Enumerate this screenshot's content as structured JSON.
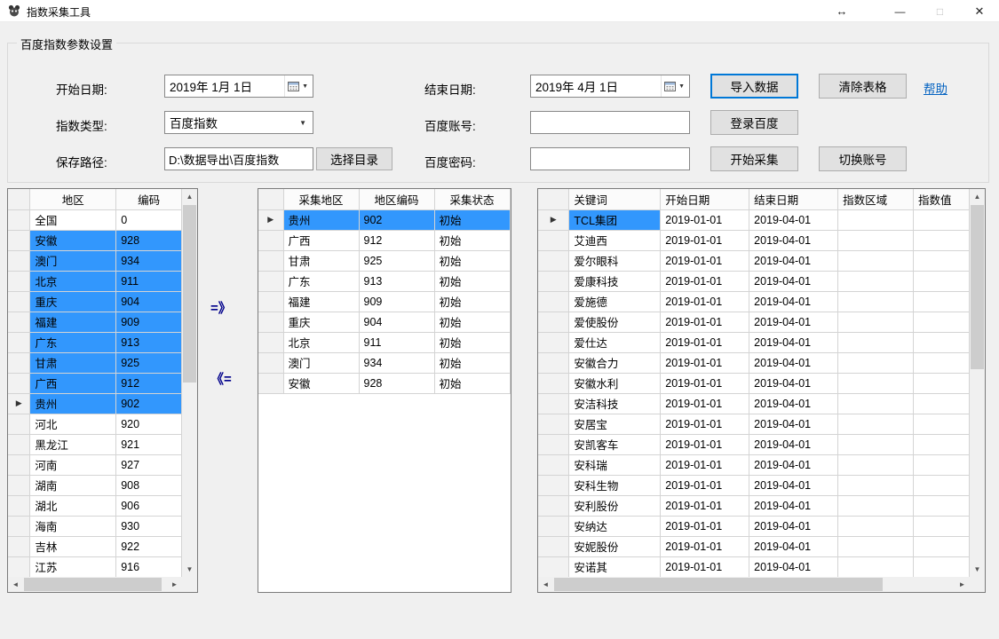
{
  "window": {
    "title": "指数采集工具",
    "resize_glyph": "↔",
    "minimize_glyph": "—",
    "maximize_glyph": "□",
    "close_glyph": "✕"
  },
  "settings": {
    "group_title": "百度指数参数设置",
    "start_date": {
      "label": "开始日期:",
      "value": "2019年 1月 1日"
    },
    "end_date": {
      "label": "结束日期:",
      "value": "2019年 4月 1日"
    },
    "index_type": {
      "label": "指数类型:",
      "value": "百度指数"
    },
    "account": {
      "label": "百度账号:",
      "value": ""
    },
    "save_path": {
      "label": "保存路径:",
      "value": "D:\\数据导出\\百度指数"
    },
    "password": {
      "label": "百度密码:",
      "value": ""
    },
    "buttons": {
      "import": "导入数据",
      "clear": "清除表格",
      "help": "帮助",
      "login": "登录百度",
      "browse": "选择目录",
      "start": "开始采集",
      "switch": "切换账号"
    }
  },
  "transfer": {
    "move_right": "=》",
    "move_left": "《="
  },
  "grids": {
    "region": {
      "columns": [
        "地区",
        "编码"
      ],
      "rows": [
        [
          "全国",
          "0"
        ],
        [
          "安徽",
          "928"
        ],
        [
          "澳门",
          "934"
        ],
        [
          "北京",
          "911"
        ],
        [
          "重庆",
          "904"
        ],
        [
          "福建",
          "909"
        ],
        [
          "广东",
          "913"
        ],
        [
          "甘肃",
          "925"
        ],
        [
          "广西",
          "912"
        ],
        [
          "贵州",
          "902"
        ],
        [
          "河北",
          "920"
        ],
        [
          "黑龙江",
          "921"
        ],
        [
          "河南",
          "927"
        ],
        [
          "湖南",
          "908"
        ],
        [
          "湖北",
          "906"
        ],
        [
          "海南",
          "930"
        ],
        [
          "吉林",
          "922"
        ],
        [
          "江苏",
          "916"
        ]
      ],
      "selected_rows": [
        1,
        2,
        3,
        4,
        5,
        6,
        7,
        8,
        9
      ],
      "current_row": 9
    },
    "collect": {
      "columns": [
        "采集地区",
        "地区编码",
        "采集状态"
      ],
      "rows": [
        [
          "贵州",
          "902",
          "初始"
        ],
        [
          "广西",
          "912",
          "初始"
        ],
        [
          "甘肃",
          "925",
          "初始"
        ],
        [
          "广东",
          "913",
          "初始"
        ],
        [
          "福建",
          "909",
          "初始"
        ],
        [
          "重庆",
          "904",
          "初始"
        ],
        [
          "北京",
          "911",
          "初始"
        ],
        [
          "澳门",
          "934",
          "初始"
        ],
        [
          "安徽",
          "928",
          "初始"
        ]
      ],
      "selected_rows": [
        0
      ],
      "current_row": 0
    },
    "keyword": {
      "columns": [
        "关键词",
        "开始日期",
        "结束日期",
        "指数区域",
        "指数值"
      ],
      "rows": [
        [
          "TCL集团",
          "2019-01-01",
          "2019-04-01",
          "",
          ""
        ],
        [
          "艾迪西",
          "2019-01-01",
          "2019-04-01",
          "",
          ""
        ],
        [
          "爱尔眼科",
          "2019-01-01",
          "2019-04-01",
          "",
          ""
        ],
        [
          "爱康科技",
          "2019-01-01",
          "2019-04-01",
          "",
          ""
        ],
        [
          "爱施德",
          "2019-01-01",
          "2019-04-01",
          "",
          ""
        ],
        [
          "爱使股份",
          "2019-01-01",
          "2019-04-01",
          "",
          ""
        ],
        [
          "爱仕达",
          "2019-01-01",
          "2019-04-01",
          "",
          ""
        ],
        [
          "安徽合力",
          "2019-01-01",
          "2019-04-01",
          "",
          ""
        ],
        [
          "安徽水利",
          "2019-01-01",
          "2019-04-01",
          "",
          ""
        ],
        [
          "安洁科技",
          "2019-01-01",
          "2019-04-01",
          "",
          ""
        ],
        [
          "安居宝",
          "2019-01-01",
          "2019-04-01",
          "",
          ""
        ],
        [
          "安凯客车",
          "2019-01-01",
          "2019-04-01",
          "",
          ""
        ],
        [
          "安科瑞",
          "2019-01-01",
          "2019-04-01",
          "",
          ""
        ],
        [
          "安科生物",
          "2019-01-01",
          "2019-04-01",
          "",
          ""
        ],
        [
          "安利股份",
          "2019-01-01",
          "2019-04-01",
          "",
          ""
        ],
        [
          "安纳达",
          "2019-01-01",
          "2019-04-01",
          "",
          ""
        ],
        [
          "安妮股份",
          "2019-01-01",
          "2019-04-01",
          "",
          ""
        ],
        [
          "安诺其",
          "2019-01-01",
          "2019-04-01",
          "",
          ""
        ]
      ],
      "selected_cells": [
        [
          0,
          0
        ]
      ],
      "current_row": 0
    }
  },
  "icons": {
    "current_row_marker": "▶",
    "dropdown_arrow": "▼",
    "scroll_up": "▲",
    "scroll_down": "▼",
    "scroll_left": "◄",
    "scroll_right": "►"
  },
  "colors": {
    "selection": "#3297fd",
    "accent_border": "#0078d7",
    "link": "#0563c1"
  }
}
